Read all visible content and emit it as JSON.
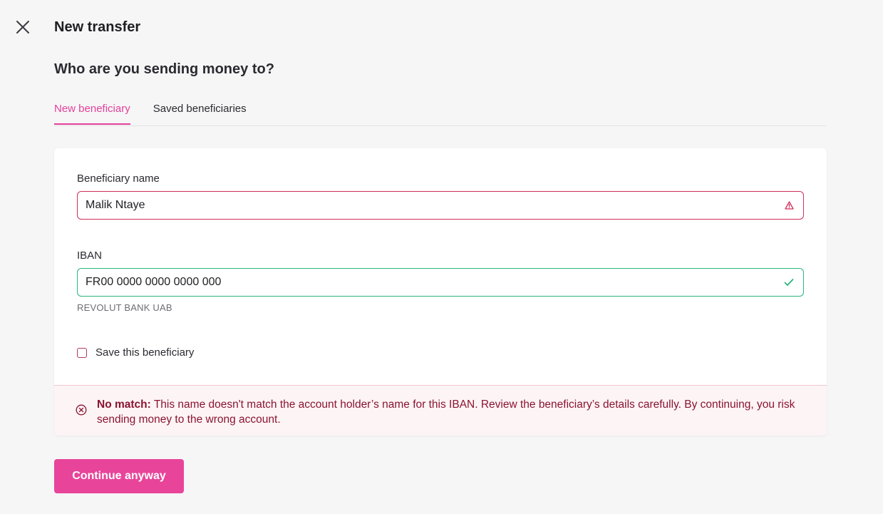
{
  "header": {
    "title": "New transfer",
    "close_icon": "close-icon"
  },
  "question": "Who are you sending money to?",
  "tabs": [
    {
      "label": "New beneficiary",
      "active": true
    },
    {
      "label": "Saved beneficiaries",
      "active": false
    }
  ],
  "form": {
    "beneficiary_name": {
      "label": "Beneficiary name",
      "value": "Malik Ntaye",
      "status": "error",
      "status_icon": "warning-icon"
    },
    "iban": {
      "label": "IBAN",
      "value": "FR00 0000 0000 0000 000",
      "status": "valid",
      "status_icon": "check-icon",
      "bank_name": "REVOLUT BANK UAB"
    },
    "save_beneficiary": {
      "label": "Save this beneficiary",
      "checked": false
    }
  },
  "alert": {
    "icon": "error-circle-icon",
    "title": "No match:",
    "message": "This name doesn't match the account holder’s name for this IBAN. Review the beneficiary’s details carefully. By continuing, you risk sending money to the wrong account."
  },
  "actions": {
    "continue_label": "Continue anyway"
  },
  "colors": {
    "accent": "#e8449a",
    "tab_active": "#e4409a",
    "error": "#d02f5a",
    "valid": "#2bb47d",
    "alert_text": "#8a1430",
    "alert_bg": "#fdf4f5"
  }
}
